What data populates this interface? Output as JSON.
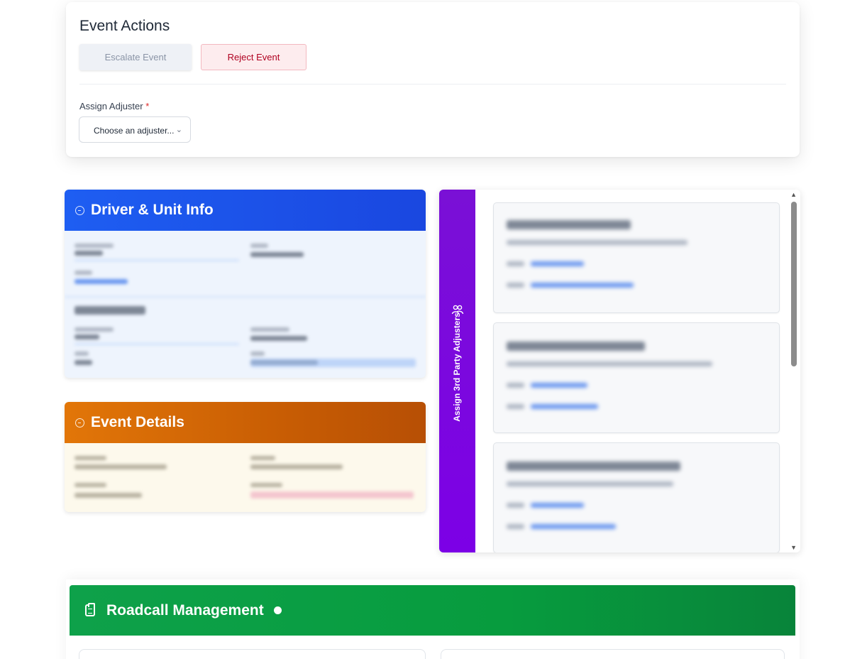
{
  "event_actions": {
    "title": "Event Actions",
    "escalate_label": "Escalate Event",
    "reject_label": "Reject Event",
    "assign_label": "Assign Adjuster",
    "required_mark": "*",
    "select_placeholder": "Choose an adjuster..."
  },
  "driver_card": {
    "title": "Driver & Unit Info",
    "icon": "info-circle-icon",
    "header_color": "#1e5ef2"
  },
  "event_card": {
    "title": "Event Details",
    "icon": "info-circle-icon",
    "header_color": "#e27608"
  },
  "adjusters_panel": {
    "tab_label": "Assign 3rd Party Adjusters",
    "tab_icon": "users-icon",
    "tab_color": "#7c00e6"
  },
  "roadcall": {
    "title": "Roadcall Management",
    "icon": "clipboard-icon",
    "header_color": "#0ea14a"
  }
}
